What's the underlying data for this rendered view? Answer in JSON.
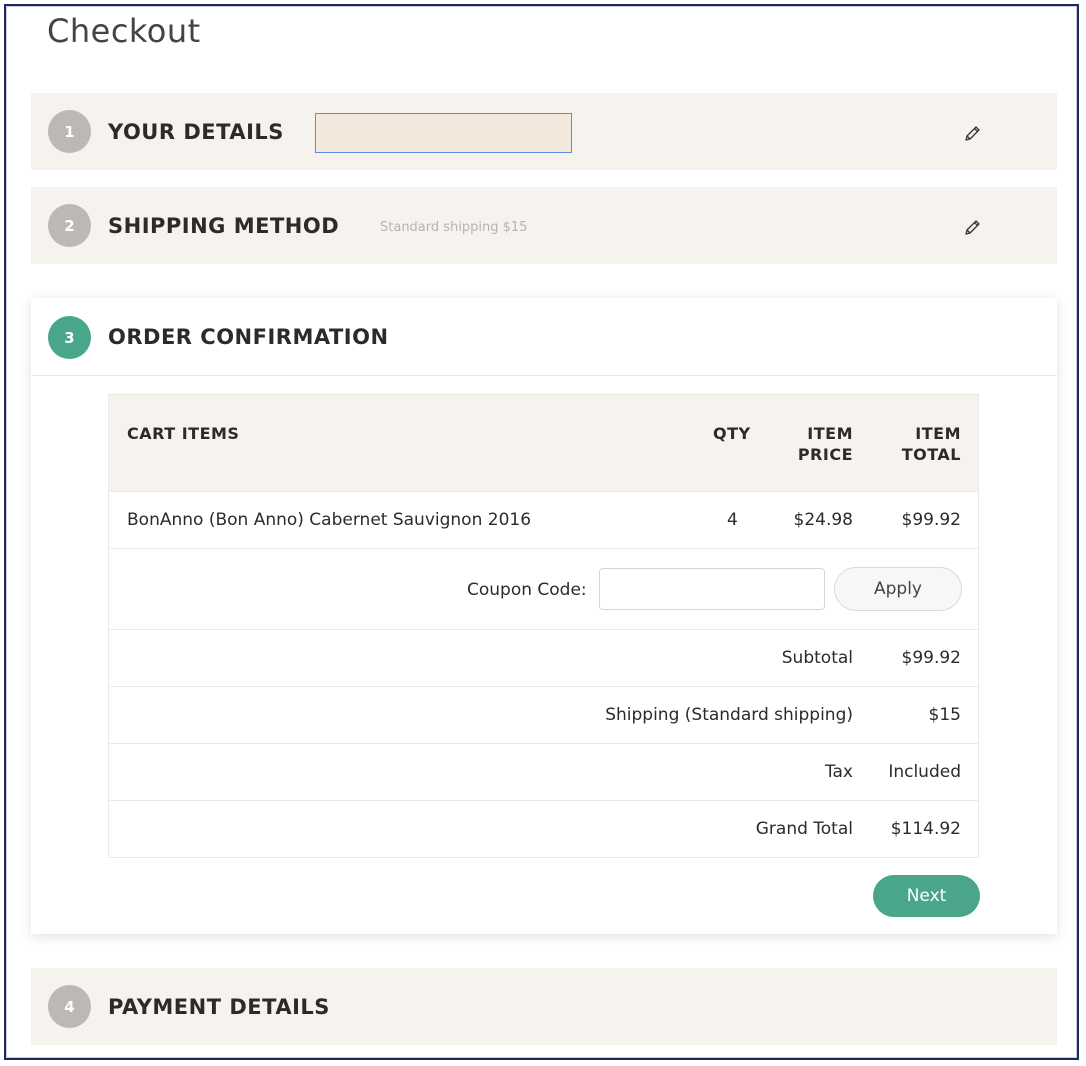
{
  "page": {
    "title": "Checkout"
  },
  "steps": [
    {
      "number": "1",
      "title": "YOUR DETAILS",
      "summary": ""
    },
    {
      "number": "2",
      "title": "SHIPPING METHOD",
      "summary": "Standard shipping $15"
    },
    {
      "number": "3",
      "title": "ORDER CONFIRMATION"
    },
    {
      "number": "4",
      "title": "PAYMENT DETAILS"
    }
  ],
  "cart": {
    "headers": {
      "items": "CART ITEMS",
      "qty": "QTY",
      "price_line1": "ITEM",
      "price_line2": "PRICE",
      "total_line1": "ITEM",
      "total_line2": "TOTAL"
    },
    "items": [
      {
        "name": "BonAnno (Bon Anno) Cabernet Sauvignon 2016",
        "qty": "4",
        "price": "$24.98",
        "total": "$99.92"
      }
    ],
    "coupon": {
      "label": "Coupon Code:",
      "value": "",
      "placeholder": "",
      "apply_label": "Apply"
    },
    "summary": [
      {
        "label": "Subtotal",
        "value": "$99.92"
      },
      {
        "label": "Shipping (Standard shipping)",
        "value": "$15"
      },
      {
        "label": "Tax",
        "value": "Included"
      },
      {
        "label": "Grand Total",
        "value": "$114.92"
      }
    ]
  },
  "actions": {
    "next_label": "Next"
  },
  "colors": {
    "accent": "#4aa68a",
    "step_inactive": "#bdb8b3",
    "panel_bg": "#f6f2ee",
    "details_fill": "#f3e8dc"
  },
  "icons": {
    "edit": "pencil-icon"
  }
}
